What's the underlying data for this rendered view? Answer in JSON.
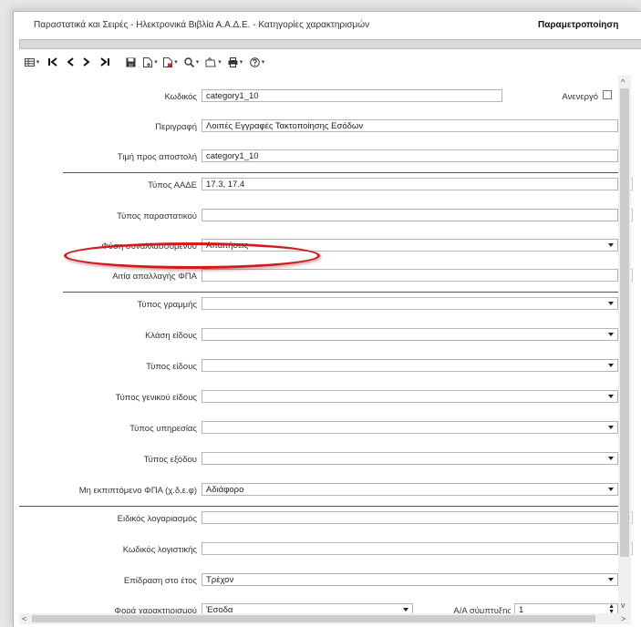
{
  "window": {
    "title": "Παραστατικά και Σειρές - Ηλεκτρονικά Βιβλία Α.Α.Δ.Ε. - Κατηγορίες χαρακτηρισμών",
    "title_right": "Παραμετροποίηση"
  },
  "toolbar": {
    "icons": [
      "grid-icon",
      "first-record-icon",
      "previous-record-icon",
      "next-record-icon",
      "last-record-icon",
      "save-icon",
      "new-document-icon",
      "delete-document-icon",
      "search-icon",
      "attach-icon",
      "print-icon",
      "help-icon"
    ]
  },
  "form": {
    "code_label": "Κωδικός",
    "code_value": "category1_10",
    "inactive_label": "Ανενεργό",
    "description_label": "Περιγραφή",
    "description_value": "Λοιπές Εγγραφές Τακτοποίησης Εσόδων",
    "export_value_label": "Τιμή προς αποστολή",
    "export_value_value": "category1_10",
    "aade_type_label": "Τύπος ΑΑΔΕ",
    "aade_type_value": "17.3, 17.4",
    "document_type_label": "Τύπος παραστατικού",
    "document_type_value": "",
    "counterparty_nature_label": "Φύση συναλλασσόμενου",
    "counterparty_nature_value": "Απαιτήσεις",
    "vat_exemption_label": "Αιτία απαλλαγής ΦΠΑ",
    "vat_exemption_value": "",
    "line_type_label": "Τύπος γραμμής",
    "line_type_value": "",
    "item_class_label": "Κλάση είδους",
    "item_class_value": "",
    "item_type_label": "Τύπος είδους",
    "item_type_value": "",
    "general_item_type_label": "Τύπος γενικού είδους",
    "general_item_type_value": "",
    "service_type_label": "Τύπος υπηρεσίας",
    "service_type_value": "",
    "expense_type_label": "Τύπος εξόδου",
    "expense_type_value": "",
    "non_deductible_vat_label": "Μη εκπιπτόμενο ΦΠΑ (χ.δ.ε.φ)",
    "non_deductible_vat_value": "Αδιάφορο",
    "special_account_label": "Ειδικός λογαριασμός",
    "special_account_value": "",
    "accounting_code_label": "Κωδικός λογιστικής",
    "accounting_code_value": "",
    "year_effect_label": "Επίδραση στο έτος",
    "year_effect_value": "Τρέχον",
    "direction_label": "Φορά χαρακτηρισμού",
    "direction_value": "Έσοδα",
    "aa_label": "Α/Α σύμπτυξης",
    "aa_value": "1"
  },
  "colors": {
    "highlight_oval": "#d11a1a",
    "separator": "#555555"
  }
}
